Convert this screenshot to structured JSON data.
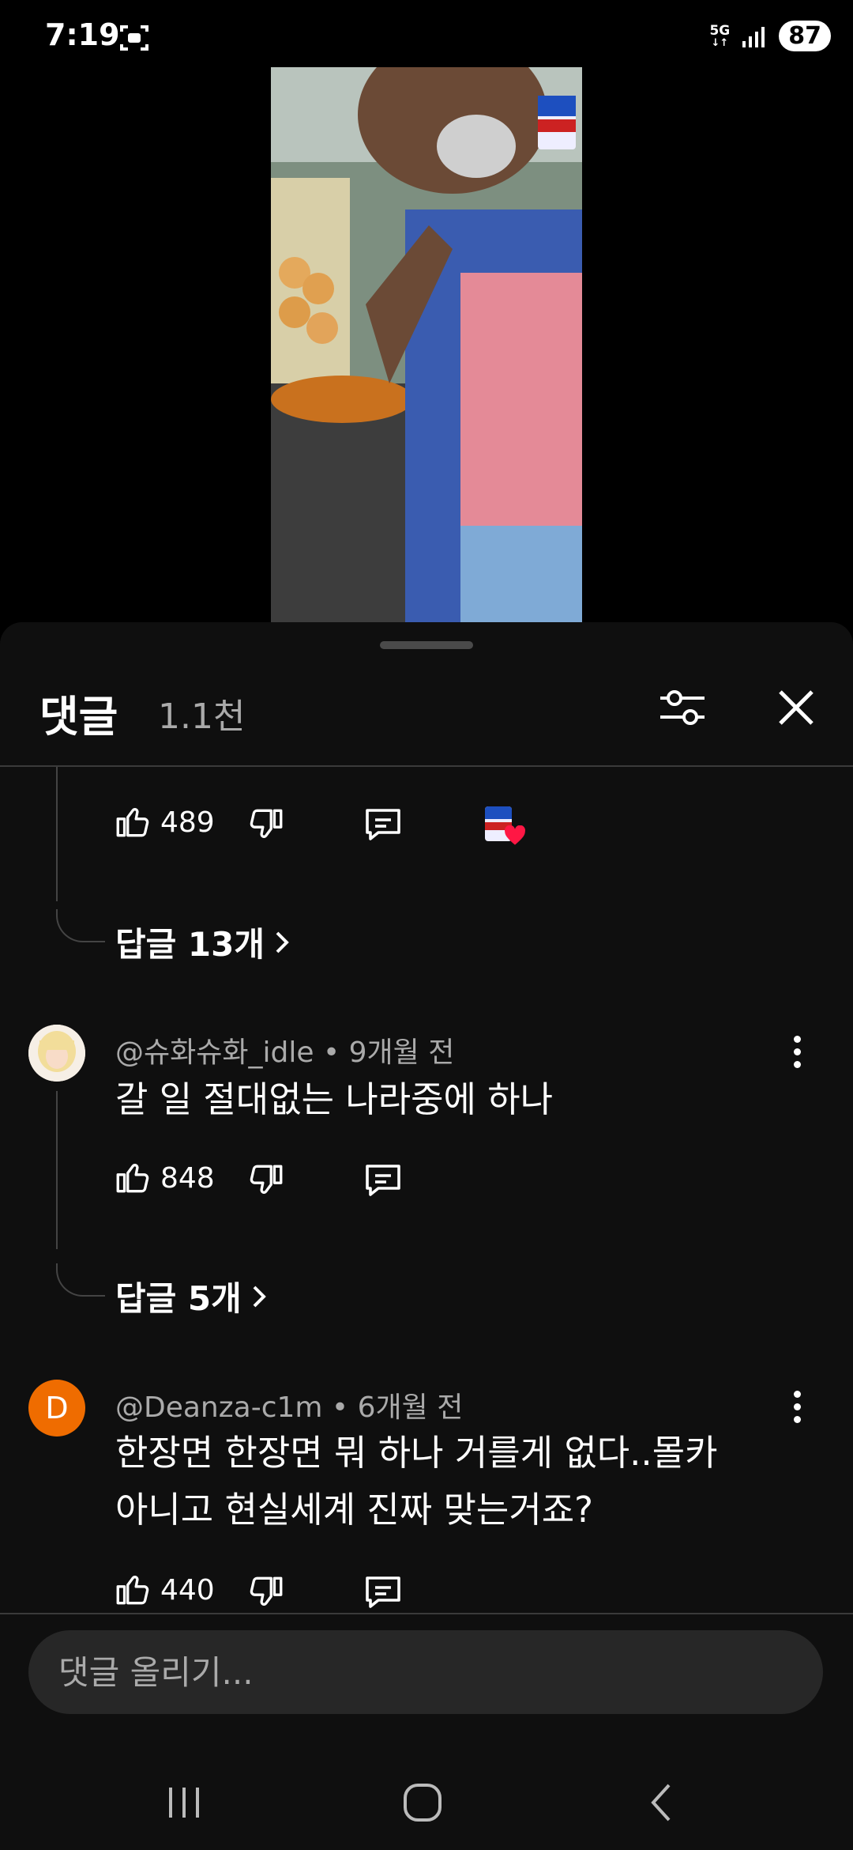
{
  "status_bar": {
    "time": "7:19",
    "network": "5G",
    "battery": "87"
  },
  "comments": {
    "title": "댓글",
    "count": "1.1천",
    "input_placeholder": "댓글 올리기..."
  },
  "partial_comment": {
    "likes": "489",
    "replies_label": "답글 13개"
  },
  "items": [
    {
      "author": "@슈화슈화_idle",
      "time": "9개월 전",
      "text_lines": [
        "갈 일 절대없는 나라중에 하나"
      ],
      "likes": "848",
      "replies_label": "답글 5개"
    },
    {
      "author": "@Deanza-c1m",
      "avatar_letter": "D",
      "time": "6개월 전",
      "text_lines": [
        "한장면 한장면 뭐 하나 거를게 없다..몰카",
        "아니고 현실세계 진짜 맞는거죠?"
      ],
      "likes": "440"
    }
  ],
  "colors": {
    "sheet_bg": "#0f0f0f",
    "avatar_d": "#ef6c00",
    "heart": "#ff1744"
  }
}
